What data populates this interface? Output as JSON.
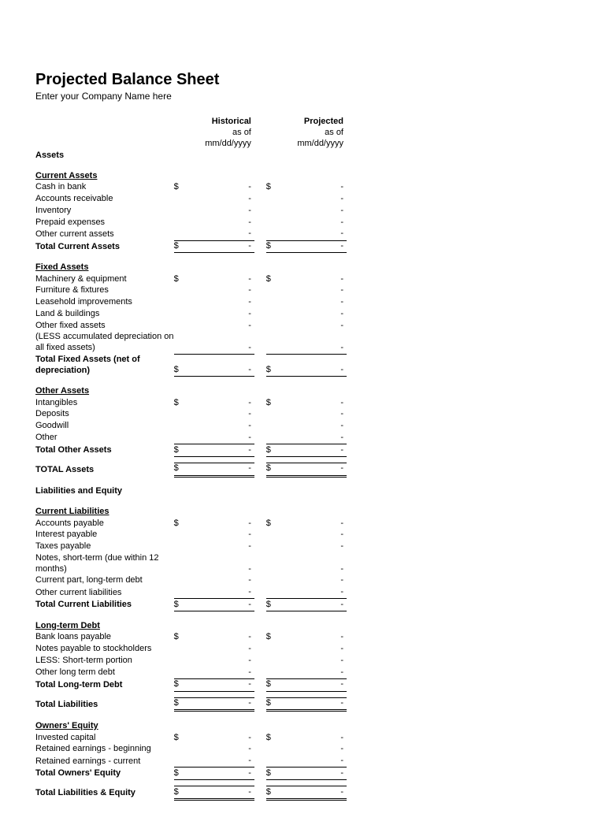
{
  "title": "Projected Balance Sheet",
  "subtitle": "Enter your Company Name here",
  "col_historical_title": "Historical",
  "col_projected_title": "Projected",
  "col_date_caption": "as of mm/dd/yyyy",
  "dash": "-",
  "dollar": "$",
  "sections": {
    "assets_heading": "Assets",
    "current_assets_heading": "Current Assets",
    "cash_in_bank": "Cash in bank",
    "accounts_receivable": "Accounts receivable",
    "inventory": "Inventory",
    "prepaid_expenses": "Prepaid expenses",
    "other_current_assets": "Other current assets",
    "total_current_assets": "Total Current Assets",
    "fixed_assets_heading": "Fixed Assets",
    "machinery": "Machinery & equipment",
    "furniture": "Furniture & fixtures",
    "leasehold": "Leasehold improvements",
    "land": "Land & buildings",
    "other_fixed": "Other fixed assets",
    "less_dep": "(LESS accumulated depreciation on all fixed assets)",
    "total_fixed": "Total Fixed Assets (net of depreciation)",
    "other_assets_heading": "Other Assets",
    "intangibles": "Intangibles",
    "deposits": "Deposits",
    "goodwill": "Goodwill",
    "other": "Other",
    "total_other": "Total Other Assets",
    "total_assets": "TOTAL Assets",
    "liab_equity_heading": "Liabilities and Equity",
    "current_liab_heading": "Current Liabilities",
    "accounts_payable": "Accounts payable",
    "interest_payable": "Interest payable",
    "taxes_payable": "Taxes payable",
    "notes_short": "Notes, short-term (due within 12 months)",
    "current_part_lt": "Current part, long-term debt",
    "other_current_liab": "Other current liabilities",
    "total_current_liab": "Total Current Liabilities",
    "lt_debt_heading": "Long-term Debt",
    "bank_loans": "Bank loans payable",
    "notes_stockholders": "Notes payable to stockholders",
    "less_st_portion": "LESS: Short-term portion",
    "other_lt_debt": "Other long term debt",
    "total_lt_debt": "Total Long-term Debt",
    "total_liabilities": "Total Liabilities",
    "owners_equity_heading": "Owners' Equity",
    "invested_capital": "Invested capital",
    "retained_begin": "Retained earnings - beginning",
    "retained_current": "Retained earnings - current",
    "total_owners_equity": "Total Owners' Equity",
    "total_liab_equity": "Total Liabilities & Equity"
  }
}
